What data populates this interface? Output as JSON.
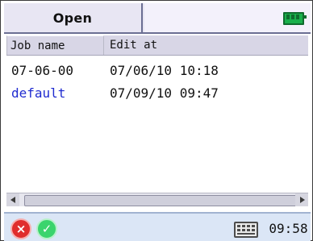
{
  "window": {
    "title": "Open"
  },
  "table": {
    "headers": [
      "Job name",
      "Edit at"
    ],
    "rows": [
      {
        "job": "07-06-00",
        "edited": "07/06/10 10:18",
        "job_color": "#111111"
      },
      {
        "job": "default",
        "edited": "07/09/10 09:47",
        "job_color": "#1f2bd0"
      }
    ]
  },
  "status": {
    "time": "09:58",
    "battery_icon": "battery-icon",
    "keyboard_icon": "keyboard-icon",
    "cancel_icon": "cancel-icon",
    "ok_icon": "ok-icon"
  },
  "colors": {
    "topbar_bg": "#e8e6f3",
    "header_bg": "#d8d6e6",
    "bottombar_bg": "#dbe6f6",
    "battery_green": "#19b04b",
    "cancel_red": "#e02d2d",
    "ok_green": "#3bd46d"
  }
}
